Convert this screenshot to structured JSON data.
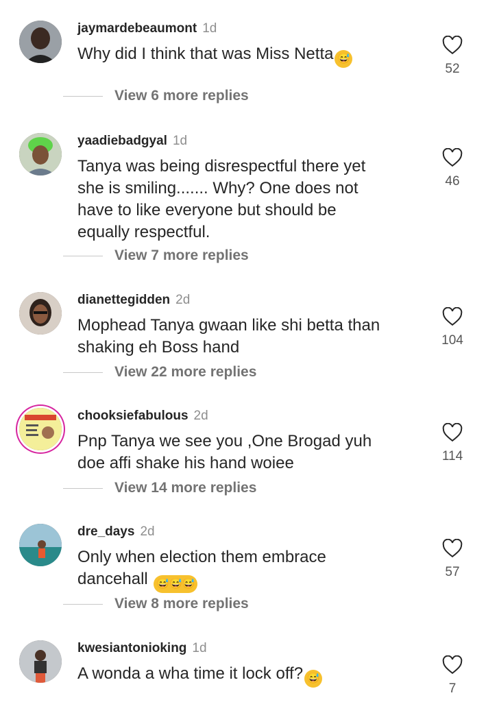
{
  "comments": [
    {
      "username": "jaymardebeaumont",
      "time": "1d",
      "text": "Why did I think that was Miss Netta",
      "emoji": "😅",
      "likes": "52",
      "replies": "View 6 more replies"
    },
    {
      "username": "yaadiebadgyal",
      "time": "1d",
      "text": "Tanya was being disrespectful there yet\nshe is smiling....... Why? One does not\nhave to like everyone but should be\nequally respectful.",
      "emoji": "",
      "likes": "46",
      "replies": "View 7 more replies"
    },
    {
      "username": "dianettegidden",
      "time": "2d",
      "text": "Mophead Tanya gwaan like shi betta than\nshaking eh Boss hand",
      "emoji": "",
      "likes": "104",
      "replies": "View 22 more replies"
    },
    {
      "username": "chooksiefabulous",
      "time": "2d",
      "text": "Pnp Tanya we see you ,One  Brogad yuh\ndoe affi shake his hand woiee",
      "emoji": "",
      "likes": "114",
      "replies": "View 14 more replies"
    },
    {
      "username": "dre_days",
      "time": "2d",
      "text": "Only when election them embrace\ndancehall",
      "emoji": "😅😅😅",
      "likes": "57",
      "replies": "View 8 more replies"
    },
    {
      "username": "kwesiantonioking",
      "time": "1d",
      "text": "A wonda a wha time it lock off?",
      "emoji": "😅",
      "likes": "7",
      "replies": ""
    }
  ]
}
